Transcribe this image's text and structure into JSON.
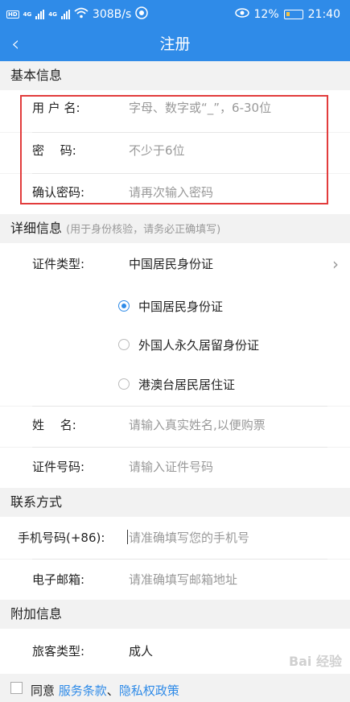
{
  "status_bar": {
    "hd_badge": "HD",
    "signal_1": "4G",
    "signal_2": "4G",
    "net_speed": "308B/s",
    "battery": "12%",
    "time": "21:40"
  },
  "nav": {
    "back_icon": "chevron-left-icon",
    "title": "注册"
  },
  "sections": {
    "basic": {
      "title": "基本信息"
    },
    "detail": {
      "title": "详细信息",
      "hint": "(用于身份核验，请务必正确填写)"
    },
    "contact": {
      "title": "联系方式"
    },
    "extra": {
      "title": "附加信息"
    }
  },
  "basic": {
    "username_label": "用 户 名:",
    "username_placeholder": "字母、数字或“_”，6-30位",
    "password_label": "密　 码:",
    "password_placeholder": "不少于6位",
    "confirm_label": "确认密码:",
    "confirm_placeholder": "请再次输入密码"
  },
  "detail": {
    "id_type_label": "证件类型:",
    "id_type_value": "中国居民身份证",
    "options": [
      {
        "label": "中国居民身份证",
        "selected": true
      },
      {
        "label": "外国人永久居留身份证",
        "selected": false
      },
      {
        "label": "港澳台居民居住证",
        "selected": false
      }
    ],
    "name_label": "姓　 名:",
    "name_placeholder": "请输入真实姓名,以便购票",
    "id_number_label": "证件号码:",
    "id_number_placeholder": "请输入证件号码"
  },
  "contact": {
    "phone_label": "手机号码(+86):",
    "phone_placeholder": "请准确填写您的手机号",
    "email_label": "电子邮箱:",
    "email_placeholder": "请准确填写邮箱地址"
  },
  "extra": {
    "passenger_type_label": "旅客类型:",
    "passenger_type_value": "成人"
  },
  "footer": {
    "agree_text": "同意 ",
    "terms_link": "服务条款",
    "separator": "、",
    "privacy_link": "隐私权政策"
  },
  "watermark": "Bai 经验",
  "colors": {
    "primary": "#2f8be8",
    "highlight_border": "#e23c3c"
  }
}
